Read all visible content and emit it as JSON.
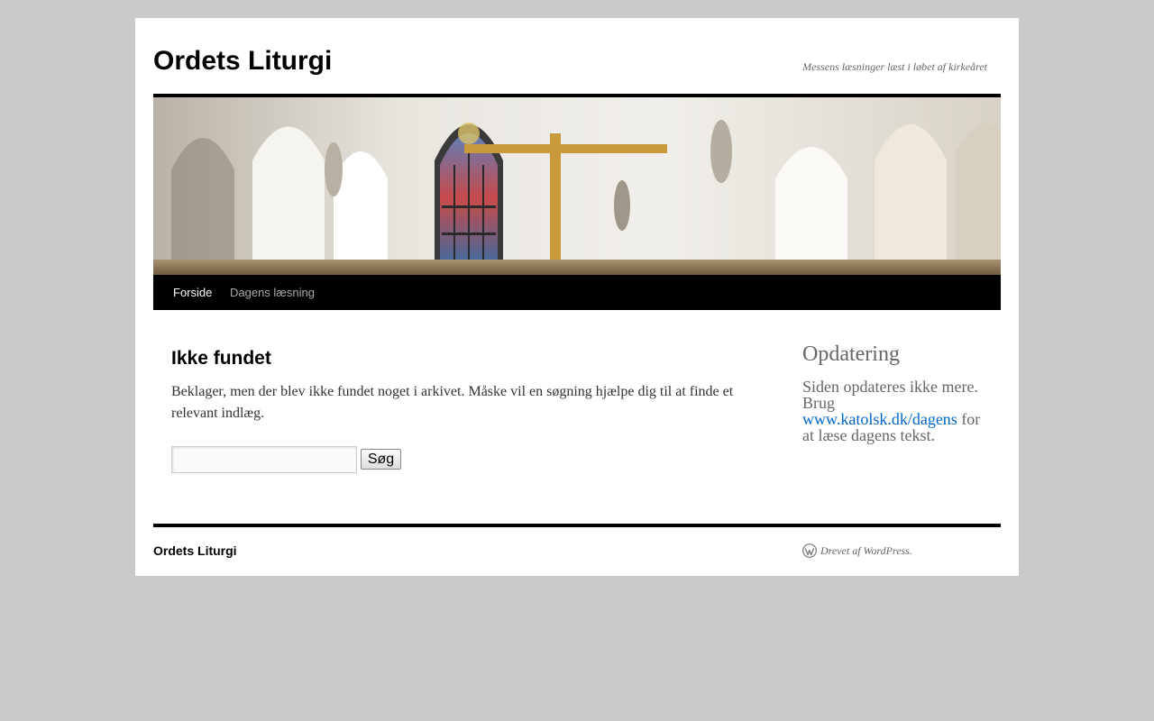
{
  "header": {
    "site_title": "Ordets Liturgi",
    "site_description": "Messens læsninger læst i løbet af kirkeåret"
  },
  "nav": {
    "items": [
      {
        "label": "Forside",
        "current": true
      },
      {
        "label": "Dagens læsning",
        "current": false
      }
    ]
  },
  "main": {
    "title": "Ikke fundet",
    "message": "Beklager, men der blev ikke fundet noget i arkivet. Måske vil en søgning hjælpe dig til at finde et relevant indlæg.",
    "search": {
      "value": "",
      "placeholder": "",
      "button_label": "Søg"
    }
  },
  "sidebar": {
    "widget_title": "Opdatering",
    "text_before": "Siden opdateres ikke mere. Brug",
    "link_text": "www.katolsk.dk/dagens",
    "text_after": "for at læse dagens tekst."
  },
  "footer": {
    "site_title": "Ordets Liturgi",
    "credit": "Drevet af WordPress."
  },
  "colors": {
    "page_background": "#c9c9c9",
    "wrapper_background": "#ffffff",
    "nav_background": "#000000",
    "nav_text": "#aaaaaa",
    "nav_current": "#ffffff",
    "link": "#0066cc"
  },
  "icons": {
    "footer_credit": "wordpress-icon"
  }
}
